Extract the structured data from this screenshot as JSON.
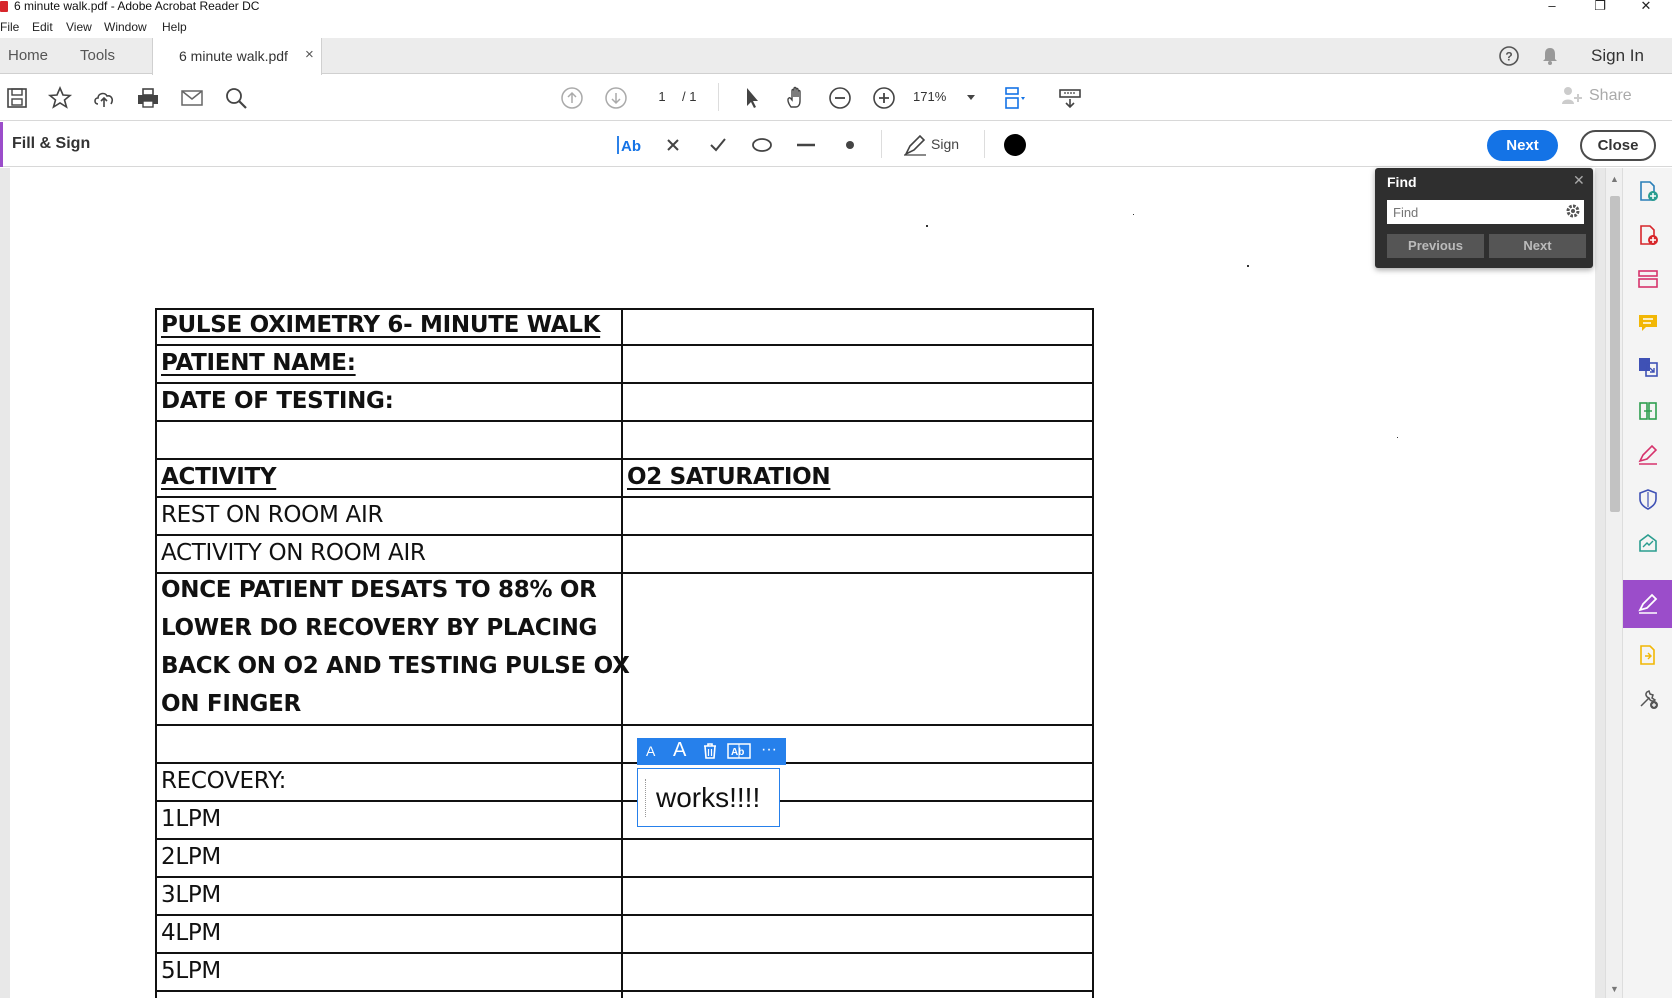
{
  "window": {
    "title": "6 minute walk.pdf - Adobe Acrobat Reader DC",
    "controls": {
      "minimize": "–",
      "restore": "❐",
      "close": "✕"
    }
  },
  "menu": [
    "File",
    "Edit",
    "View",
    "Window",
    "Help"
  ],
  "tabs": {
    "home": "Home",
    "tools": "Tools",
    "document": "6 minute walk.pdf",
    "close_symbol": "×",
    "sign_in": "Sign In"
  },
  "toolbar": {
    "page_current": "1",
    "page_total": "/ 1",
    "zoom": "171%",
    "share": "Share"
  },
  "fill_sign": {
    "title": "Fill & Sign",
    "sign": "Sign",
    "next": "Next",
    "close": "Close",
    "color": "#000000"
  },
  "find_panel": {
    "title": "Find",
    "placeholder": "Find",
    "previous": "Previous",
    "next": "Next"
  },
  "form": {
    "rows": [
      {
        "left": "PULSE OXIMETRY 6- MINUTE WALK",
        "right": ""
      },
      {
        "left": "PATIENT NAME:",
        "right": ""
      },
      {
        "left": "DATE OF TESTING:",
        "right": ""
      },
      {
        "left": "",
        "right": ""
      },
      {
        "left": "ACTIVITY",
        "right": "O2 SATURATION"
      },
      {
        "left": "REST ON ROOM AIR",
        "right": ""
      },
      {
        "left": "ACTIVITY ON ROOM AIR",
        "right": ""
      },
      {
        "left_lines": [
          "ONCE PATIENT DESATS TO 88% OR",
          "LOWER DO RECOVERY BY PLACING",
          "BACK ON O2 AND TESTING PULSE OX",
          "ON FINGER"
        ],
        "right": ""
      },
      {
        "left": "",
        "right": ""
      },
      {
        "left": "RECOVERY:",
        "right": ""
      },
      {
        "left": "1LPM",
        "right": ""
      },
      {
        "left": "2LPM",
        "right": ""
      },
      {
        "left": "3LPM",
        "right": ""
      },
      {
        "left": "4LPM",
        "right": ""
      },
      {
        "left": "5LPM",
        "right": ""
      }
    ],
    "text_field_value": "works!!!!"
  },
  "minitoolbar": {
    "small_a": "A",
    "large_a": "A",
    "more": "···"
  },
  "colors": {
    "accent_blue": "#1473e6",
    "fill_sign_purple": "#9b4dca"
  }
}
